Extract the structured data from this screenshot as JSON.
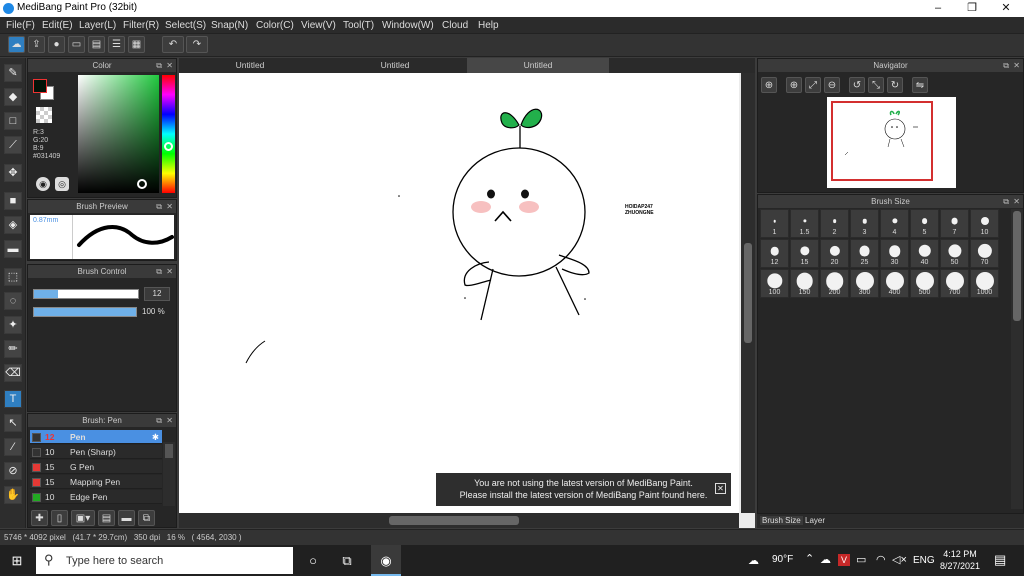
{
  "window": {
    "title": "MediBang Paint Pro (32bit)",
    "minimize": "–",
    "maximize": "❐",
    "close": "✕"
  },
  "menu": [
    {
      "label": "File(F)"
    },
    {
      "label": "Edit(E)"
    },
    {
      "label": "Layer(L)"
    },
    {
      "label": "Filter(R)"
    },
    {
      "label": "Select(S)"
    },
    {
      "label": "Snap(N)"
    },
    {
      "label": "Color(C)"
    },
    {
      "label": "View(V)"
    },
    {
      "label": "Tool(T)"
    },
    {
      "label": "Window(W)"
    },
    {
      "label": "Cloud"
    },
    {
      "label": "Help"
    }
  ],
  "toolbar_icons": [
    "cloud-icon",
    "upload-icon",
    "speech-bubble-icon",
    "comment-icon",
    "document-icon",
    "list-icon",
    "grid-icon",
    "undo-icon",
    "redo-icon"
  ],
  "color_panel": {
    "title": "Color",
    "r": "R:3",
    "g": "G:20",
    "b": "B:9",
    "hex": "#031409",
    "current_color": "#031409"
  },
  "brush_preview": {
    "title": "Brush Preview",
    "size": "0.87mm"
  },
  "brush_control": {
    "title": "Brush Control",
    "size_value": "12",
    "opacity_value": "100 %"
  },
  "brush_panel": {
    "title": "Brush: Pen",
    "items": [
      {
        "size": "12",
        "name": "Pen",
        "color": "#333333"
      },
      {
        "size": "10",
        "name": "Pen (Sharp)",
        "color": "#333333"
      },
      {
        "size": "15",
        "name": "G Pen",
        "color": "#e53935"
      },
      {
        "size": "15",
        "name": "Mapping Pen",
        "color": "#e53935"
      },
      {
        "size": "10",
        "name": "Edge Pen",
        "color": "#22aa22"
      }
    ]
  },
  "tabs": [
    {
      "label": "Untitled"
    },
    {
      "label": "Untitled"
    },
    {
      "label": "Untitled"
    }
  ],
  "canvas_text": {
    "line1": "HOIDAP247",
    "line2": "ZHUONGNE"
  },
  "notice": {
    "line1": "You are not using the latest version of MediBang Paint.",
    "line2": "Please install the latest version of MediBang Paint found here.",
    "close": "✕"
  },
  "navigator": {
    "title": "Navigator"
  },
  "brush_size": {
    "title": "Brush Size",
    "sizes": [
      "1",
      "1.5",
      "2",
      "3",
      "4",
      "5",
      "7",
      "10",
      "12",
      "15",
      "20",
      "25",
      "30",
      "40",
      "50",
      "70",
      "100",
      "150",
      "200",
      "300",
      "400",
      "500",
      "700",
      "1000"
    ]
  },
  "bottom_tabs": {
    "brush_size": "Brush Size",
    "layer": "Layer"
  },
  "status": {
    "text": "5746 * 4092 pixel   (41.7 * 29.7cm)   350 dpi   16 %   ( 4564, 2030 )"
  },
  "taskbar": {
    "search_placeholder": "Type here to search",
    "weather": "90°F",
    "lang": "ENG",
    "time": "4:12 PM",
    "date": "8/27/2021"
  }
}
